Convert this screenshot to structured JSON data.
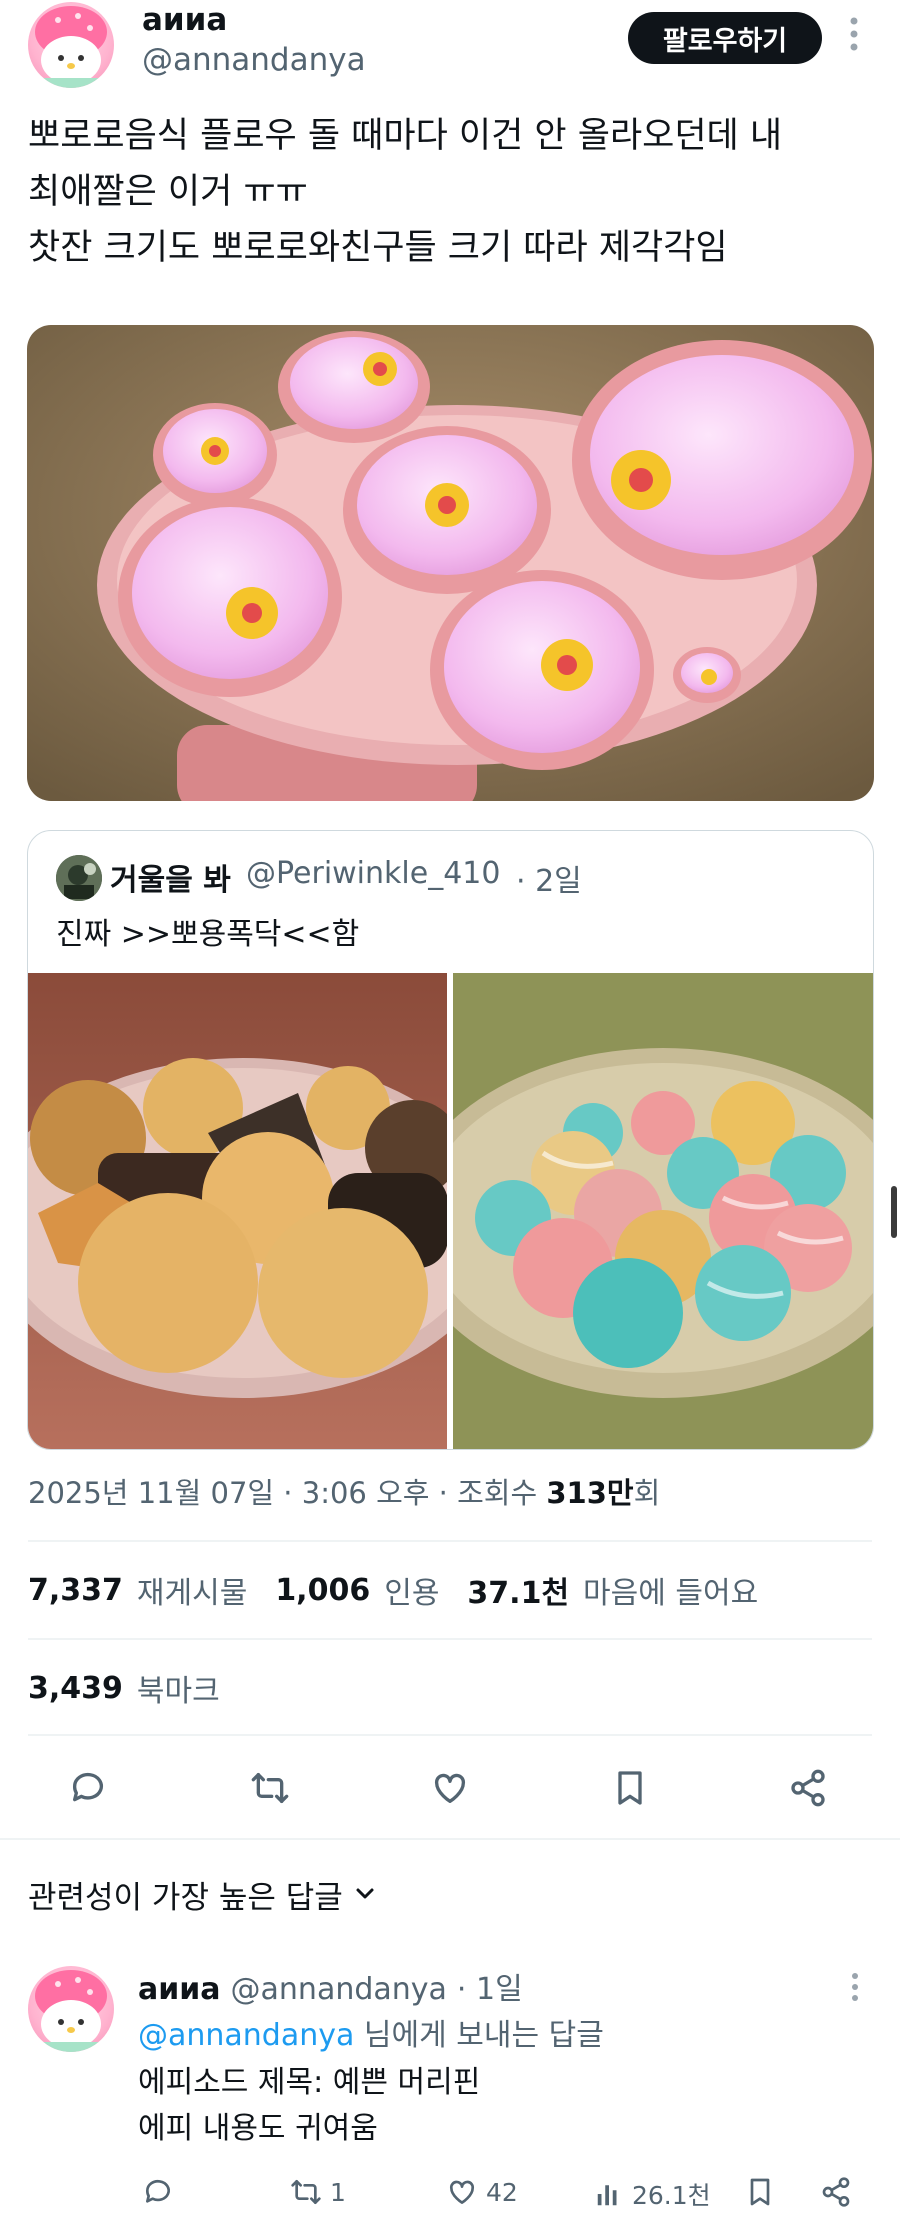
{
  "tweet": {
    "author_name": "аииа",
    "author_handle": "@annandanya",
    "follow_label": "팔로우하기",
    "text_line1": "뽀로로음식 플로우 돌 때마다 이건 안 올라오던데 내",
    "text_line2": "최애짤은 이거 ㅠㅠ",
    "text_line3": "찻잔 크기도 뽀로로와친구들 크기 따라 제각각임"
  },
  "quote": {
    "author_name": "거울을 봐",
    "author_handle": "@Periwinkle_410",
    "time": "· 2일",
    "text": "진짜 >>뽀용폭닥<<함"
  },
  "meta": {
    "date_time": "2025년 11월 07일 · 3:06 오후 · 조회수 ",
    "views_bold": "313만",
    "views_suffix": "회"
  },
  "stats": {
    "reposts_num": "7,337",
    "reposts_lbl": "재게시물",
    "quotes_num": "1,006",
    "quotes_lbl": "인용",
    "likes_num": "37.1천",
    "likes_lbl": "마음에 들어요",
    "bookmarks_num": "3,439",
    "bookmarks_lbl": "북마크"
  },
  "replies_sort": {
    "label": "관련성이 가장 높은 답글"
  },
  "reply": {
    "author_name": "аииа",
    "author_handle": "@annandanya",
    "time": "· 1일",
    "reply_to_handle": "@annandanya",
    "reply_to_suffix": " 님에게 보내는 답글",
    "line1": "에피소드 제목: 예쁜 머리핀",
    "line2": "에피 내용도 귀여움",
    "retweets": "1",
    "likes": "42",
    "views": "26.1천"
  },
  "colors": {
    "link_blue": "#1d9bf0",
    "text_primary": "#0f1419",
    "text_secondary": "#536471"
  }
}
